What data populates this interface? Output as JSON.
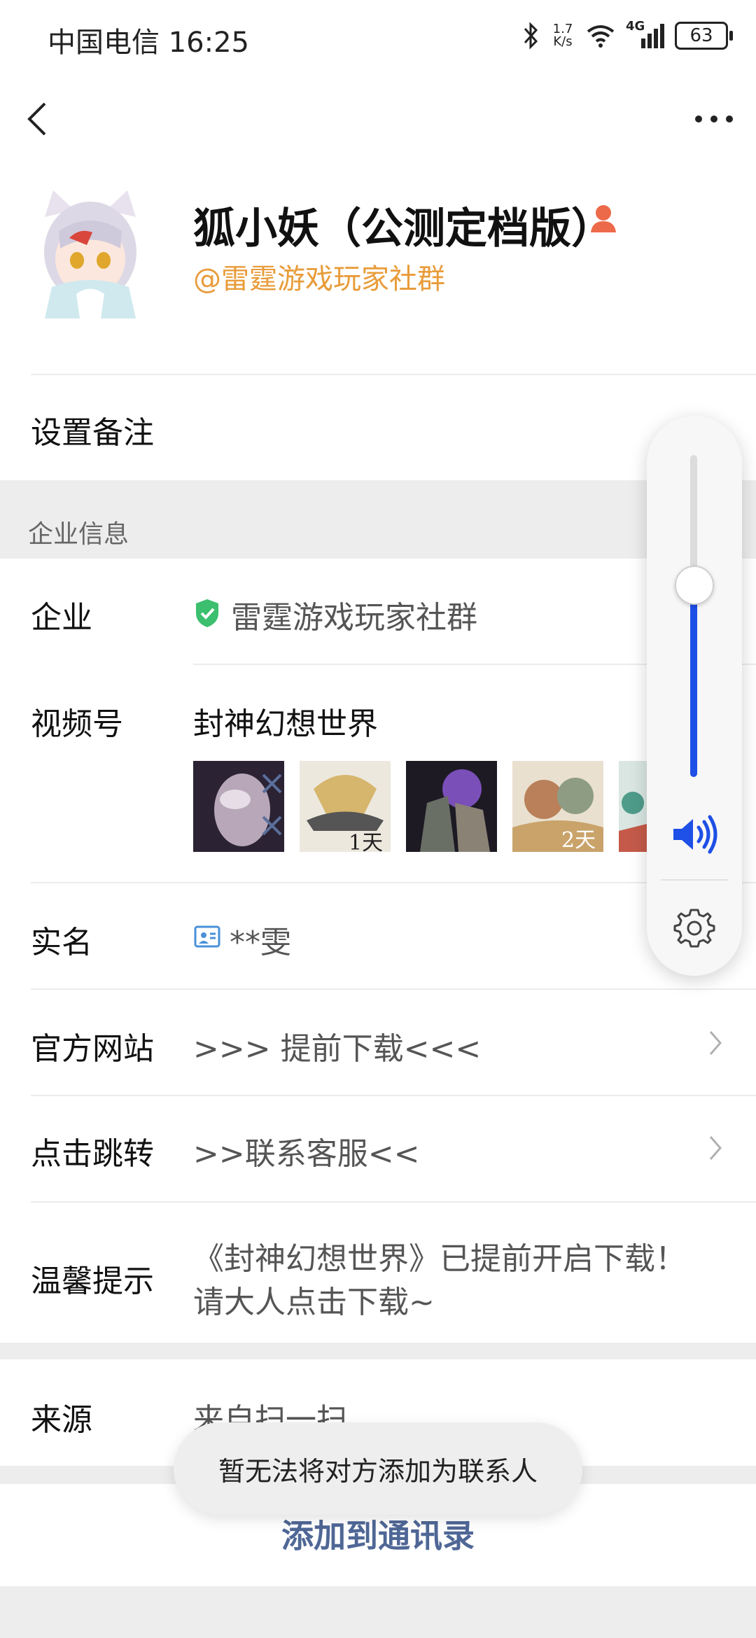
{
  "status_bar": {
    "carrier_time": "中国电信 16:25",
    "speed_value": "1.7",
    "speed_unit": "K/s",
    "network": "4G",
    "battery": "63"
  },
  "profile": {
    "name": "狐小妖（公测定档版）",
    "org": "@雷霆游戏玩家社群"
  },
  "remark": {
    "label": "设置备注"
  },
  "enterprise_section": {
    "title": "企业信息"
  },
  "rows": {
    "company": {
      "label": "企业",
      "value": "雷霆游戏玩家社群"
    },
    "channel": {
      "label": "视频号",
      "value": "封神幻想世界"
    },
    "realname": {
      "label": "实名",
      "value": "**雯"
    },
    "website": {
      "label": "官方网站",
      "value": ">>> 提前下载<<<"
    },
    "jump": {
      "label": "点击跳转",
      "value": ">>联系客服<<"
    },
    "tip": {
      "label": "温馨提示",
      "line1": "《封神幻想世界》已提前开启下载！",
      "line2": "请大人点击下载~"
    },
    "source": {
      "label": "来源",
      "value": "来自扫一扫"
    }
  },
  "thumbnails": {
    "t2": "1天",
    "t4": "2天"
  },
  "toast": {
    "text": "暂无法将对方添加为联系人"
  },
  "add_contact": {
    "label": "添加到通讯录"
  },
  "volume": {
    "level": 0.6
  },
  "colors": {
    "accent_blue": "#1e4fe6",
    "org_orange": "#e89c3a",
    "verified_green": "#3cbf6e",
    "link_blue": "#4f6796"
  }
}
